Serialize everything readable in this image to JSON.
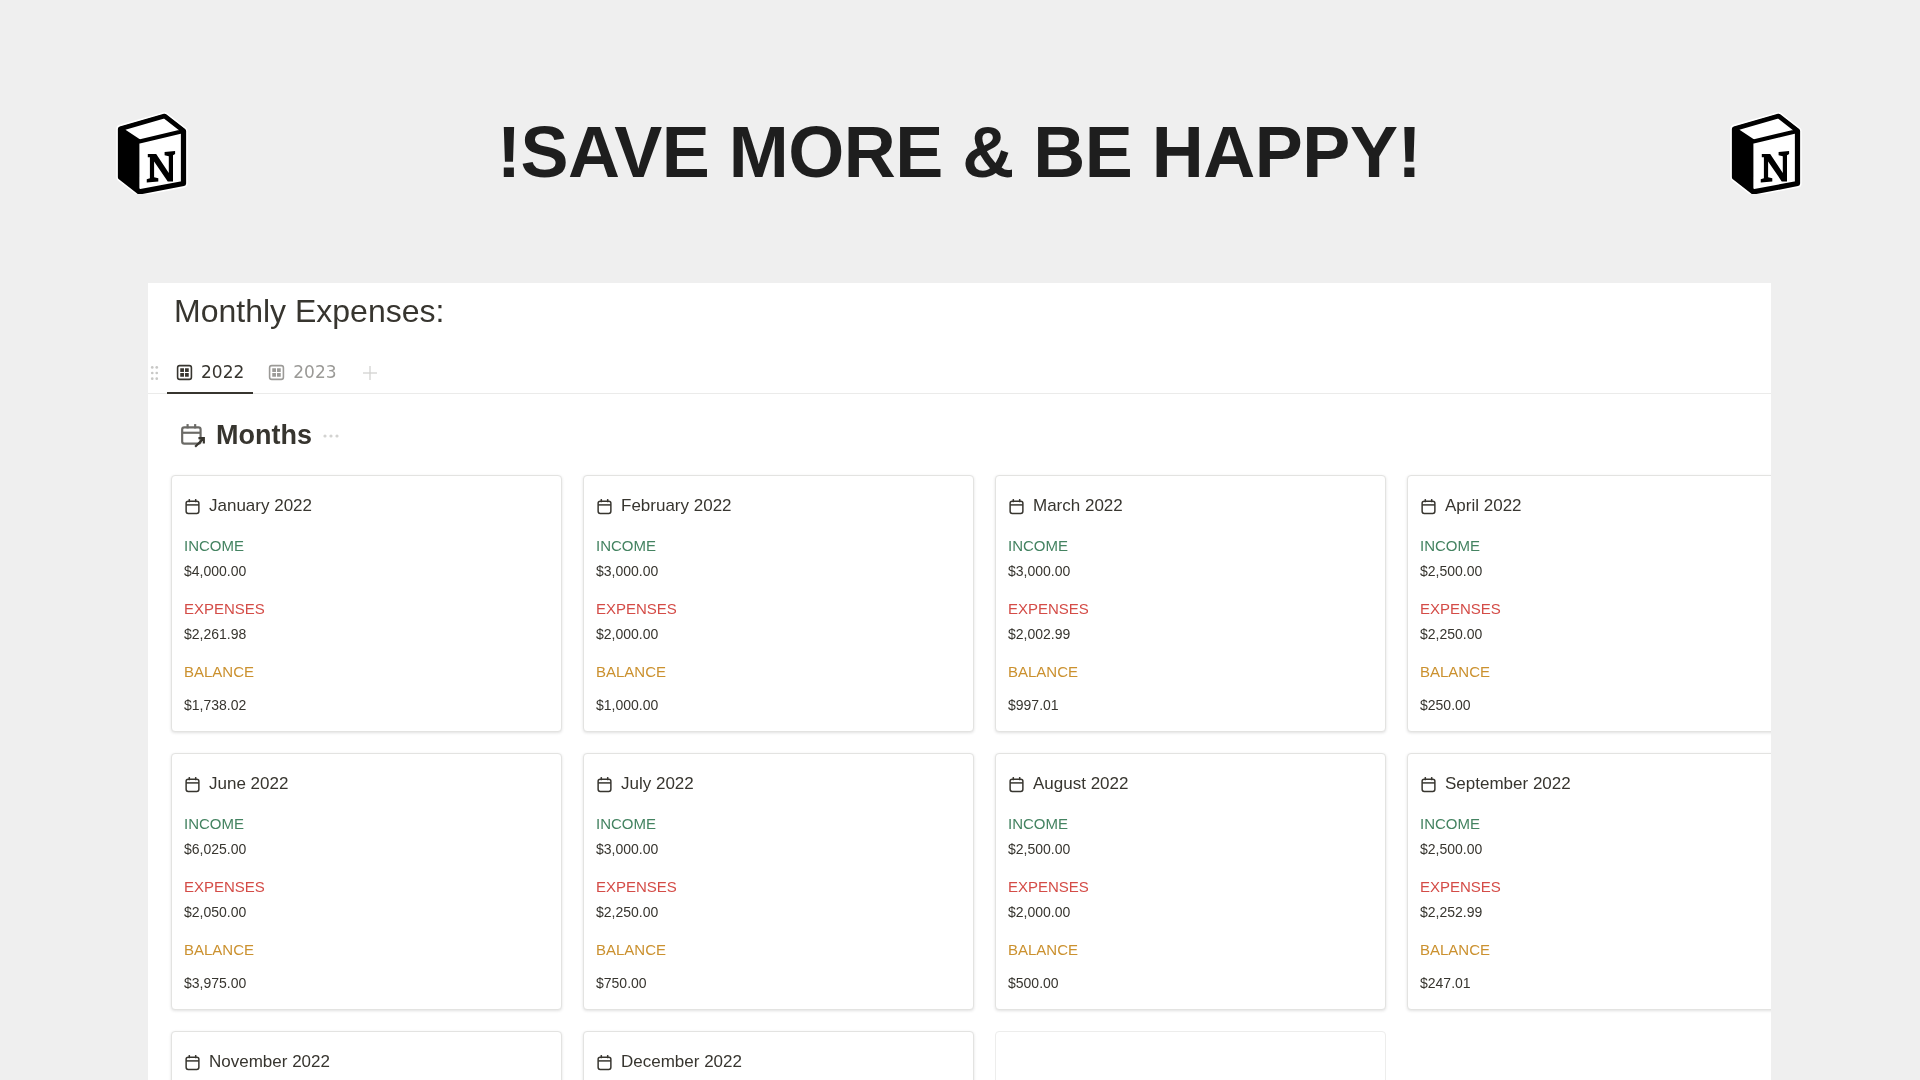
{
  "header": {
    "title": "!SAVE MORE & BE HAPPY!"
  },
  "page": {
    "title": "Monthly Expenses:"
  },
  "tabs": [
    {
      "label": "2022",
      "selected": true
    },
    {
      "label": "2023",
      "selected": false
    }
  ],
  "gallery": {
    "title": "Months",
    "cards": [
      {
        "kind": "month",
        "title": "January 2022",
        "fields": [
          {
            "kind": "income",
            "label": "INCOME",
            "value": "$4,000.00"
          },
          {
            "kind": "expenses",
            "label": "EXPENSES",
            "value": "$2,261.98"
          },
          {
            "kind": "balance",
            "label": "BALANCE",
            "value": "$1,738.02"
          }
        ]
      },
      {
        "kind": "month",
        "title": "February 2022",
        "fields": [
          {
            "kind": "income",
            "label": "INCOME",
            "value": "$3,000.00"
          },
          {
            "kind": "expenses",
            "label": "EXPENSES",
            "value": "$2,000.00"
          },
          {
            "kind": "balance",
            "label": "BALANCE",
            "value": "$1,000.00"
          }
        ]
      },
      {
        "kind": "month",
        "title": "March 2022",
        "fields": [
          {
            "kind": "income",
            "label": "INCOME",
            "value": "$3,000.00"
          },
          {
            "kind": "expenses",
            "label": "EXPENSES",
            "value": "$2,002.99"
          },
          {
            "kind": "balance",
            "label": "BALANCE",
            "value": "$997.01"
          }
        ]
      },
      {
        "kind": "month",
        "title": "April 2022",
        "fields": [
          {
            "kind": "income",
            "label": "INCOME",
            "value": "$2,500.00"
          },
          {
            "kind": "expenses",
            "label": "EXPENSES",
            "value": "$2,250.00"
          },
          {
            "kind": "balance",
            "label": "BALANCE",
            "value": "$250.00"
          }
        ]
      },
      {
        "kind": "month",
        "title": "June 2022",
        "fields": [
          {
            "kind": "income",
            "label": "INCOME",
            "value": "$6,025.00"
          },
          {
            "kind": "expenses",
            "label": "EXPENSES",
            "value": "$2,050.00"
          },
          {
            "kind": "balance",
            "label": "BALANCE",
            "value": "$3,975.00"
          }
        ]
      },
      {
        "kind": "month",
        "title": "July 2022",
        "fields": [
          {
            "kind": "income",
            "label": "INCOME",
            "value": "$3,000.00"
          },
          {
            "kind": "expenses",
            "label": "EXPENSES",
            "value": "$2,250.00"
          },
          {
            "kind": "balance",
            "label": "BALANCE",
            "value": "$750.00"
          }
        ]
      },
      {
        "kind": "month",
        "title": "August 2022",
        "fields": [
          {
            "kind": "income",
            "label": "INCOME",
            "value": "$2,500.00"
          },
          {
            "kind": "expenses",
            "label": "EXPENSES",
            "value": "$2,000.00"
          },
          {
            "kind": "balance",
            "label": "BALANCE",
            "value": "$500.00"
          }
        ]
      },
      {
        "kind": "month",
        "title": "September 2022",
        "fields": [
          {
            "kind": "income",
            "label": "INCOME",
            "value": "$2,500.00"
          },
          {
            "kind": "expenses",
            "label": "EXPENSES",
            "value": "$2,252.99"
          },
          {
            "kind": "balance",
            "label": "BALANCE",
            "value": "$247.01"
          }
        ]
      },
      {
        "kind": "month",
        "title": "November 2022"
      },
      {
        "kind": "month",
        "title": "December 2022"
      },
      {
        "kind": "blank"
      }
    ]
  }
}
